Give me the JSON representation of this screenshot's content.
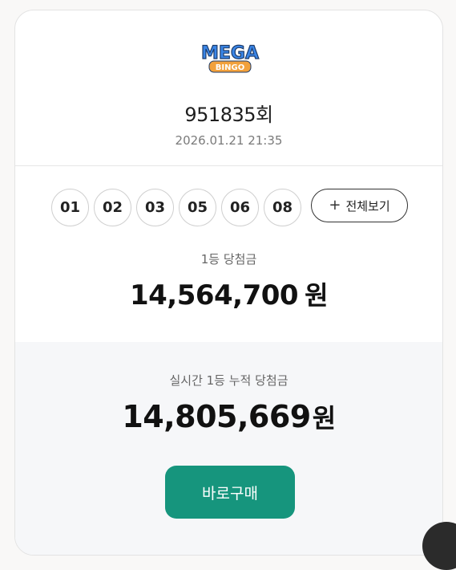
{
  "logo": {
    "line1": "MEGA",
    "line2": "BINGO"
  },
  "draw": {
    "round": "951835회",
    "datetime": "2026.01.21 21:35"
  },
  "numbers": [
    "01",
    "02",
    "03",
    "05",
    "06",
    "08"
  ],
  "view_all_label": "전체보기",
  "first_prize": {
    "label": "1등 당첨금",
    "amount": "14,564,700",
    "unit": "원"
  },
  "accumulated": {
    "label": "실시간 1등 누적 당첨금",
    "amount": "14,805,669",
    "unit": "원"
  },
  "buy_label": "바로구매",
  "colors": {
    "accent": "#16957d",
    "logo_blue": "#3a86e8",
    "logo_orange": "#f2a13c"
  }
}
